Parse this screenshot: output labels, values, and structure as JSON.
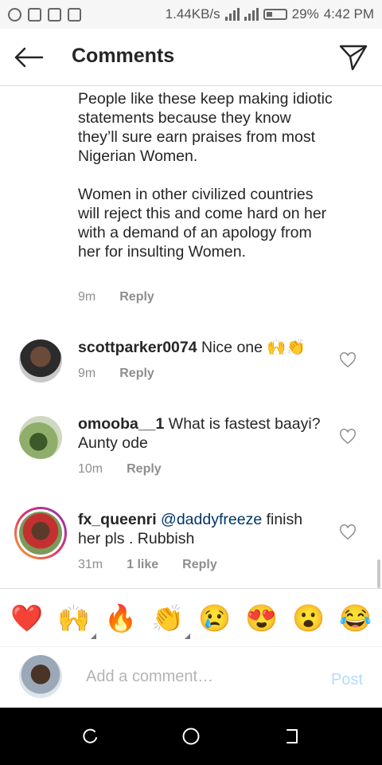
{
  "status_bar": {
    "network_speed": "1.44KB/s",
    "network_type": "3G",
    "battery": "29%",
    "time": "4:42 PM"
  },
  "header": {
    "title": "Comments",
    "back_icon": "arrow-left-icon",
    "action_icon": "send-icon"
  },
  "comments": [
    {
      "continuation": true,
      "text": "People like these keep making idiotic statements because they know they’ll sure earn praises from most Nigerian Women.\n\nWomen in other civilized countries will reject this and come hard on her with a demand of an apology from her for insulting Women.",
      "time": "9m",
      "reply_label": "Reply"
    },
    {
      "username": "scottparker0074",
      "text": "Nice one 🙌👏",
      "time": "9m",
      "reply_label": "Reply"
    },
    {
      "username": "omooba__1",
      "text": "What is fastest baayi? Aunty ode",
      "time": "10m",
      "reply_label": "Reply"
    },
    {
      "username": "fx_queenri",
      "mention": "@daddyfreeze",
      "text": " finish her pls . Rubbish",
      "time": "31m",
      "likes": "1 like",
      "reply_label": "Reply"
    }
  ],
  "emoji_bar": [
    "❤️",
    "🙌",
    "🔥",
    "👏",
    "😢",
    "😍",
    "😮",
    "😂"
  ],
  "add_comment": {
    "placeholder": "Add a comment…",
    "post_label": "Post"
  },
  "colors": {
    "text": "#262626",
    "meta": "#8e8e8e",
    "mention": "#003569",
    "post_disabled": "#b3dbff"
  }
}
